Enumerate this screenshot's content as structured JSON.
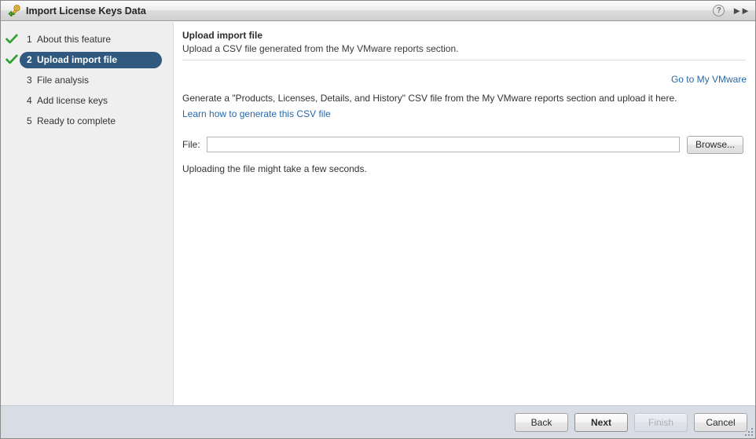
{
  "window": {
    "title": "Import License Keys Data",
    "icon": "key-import-icon",
    "help_icon": "help-icon",
    "help_label": "?",
    "expand_icon": "double-chevron-right-icon",
    "expand_label": "▸▸"
  },
  "sidebar": {
    "steps": [
      {
        "number": "1",
        "label": "About this feature",
        "completed": true,
        "active": false
      },
      {
        "number": "2",
        "label": "Upload import file",
        "completed": true,
        "active": true
      },
      {
        "number": "3",
        "label": "File analysis",
        "completed": false,
        "active": false
      },
      {
        "number": "4",
        "label": "Add license keys",
        "completed": false,
        "active": false
      },
      {
        "number": "5",
        "label": "Ready to complete",
        "completed": false,
        "active": false
      }
    ]
  },
  "main": {
    "title": "Upload import file",
    "subtitle": "Upload a CSV file generated from the My VMware reports section.",
    "go_to_my_vmware": "Go to My VMware",
    "instructions": "Generate a \"Products, Licenses, Details, and History\" CSV file from the My VMware reports section and upload it here.",
    "learn_link": "Learn how to generate this CSV file",
    "file_label": "File:",
    "file_value": "",
    "file_placeholder": "",
    "browse_label": "Browse...",
    "note": "Uploading the file might take a few seconds."
  },
  "footer": {
    "buttons": [
      {
        "label": "Back",
        "state": "enabled",
        "default": false
      },
      {
        "label": "Next",
        "state": "enabled",
        "default": true
      },
      {
        "label": "Finish",
        "state": "disabled",
        "default": false
      },
      {
        "label": "Cancel",
        "state": "enabled",
        "default": false
      }
    ],
    "resize_grip": "resize-grip-icon"
  },
  "colors": {
    "accent": "#31587e",
    "link": "#2968a8",
    "check": "#2ca02c",
    "sidebar_bg": "#efefef",
    "footer_bg": "#d8dce4"
  }
}
